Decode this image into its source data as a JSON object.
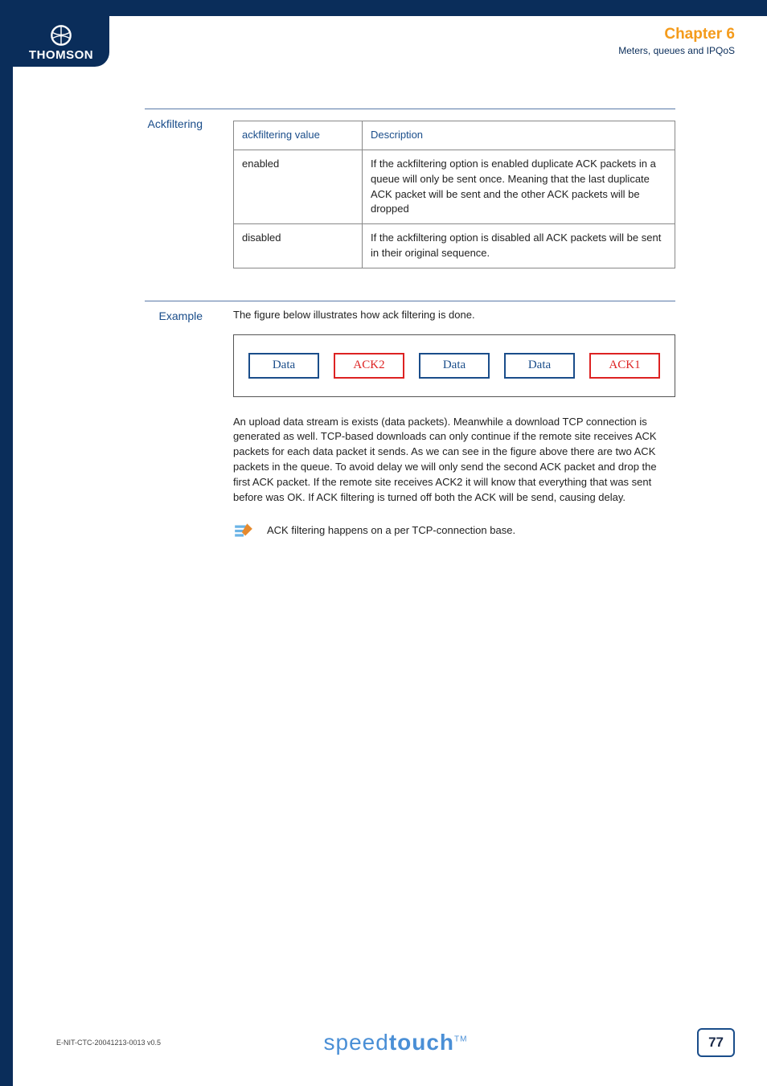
{
  "header": {
    "logo_text": "THOMSON",
    "chapter_title": "Chapter 6",
    "chapter_sub": "Meters, queues and IPQoS"
  },
  "section1": {
    "label": "Ackfiltering",
    "table": {
      "headers": [
        "ackfiltering value",
        "Description"
      ],
      "rows": [
        {
          "c0": "enabled",
          "c1": "If the ackfiltering option is enabled duplicate ACK packets in a queue will only be sent once. Meaning that the last duplicate ACK packet will be sent and the other ACK packets will be dropped"
        },
        {
          "c0": "disabled",
          "c1": "If the ackfiltering option is disabled all ACK packets will be sent in their original sequence."
        }
      ]
    }
  },
  "section2": {
    "label": "Example",
    "intro": "The figure below illustrates how ack filtering is done.",
    "packets": [
      {
        "label": "Data",
        "kind": "data"
      },
      {
        "label": "ACK2",
        "kind": "ack"
      },
      {
        "label": "Data",
        "kind": "data"
      },
      {
        "label": "Data",
        "kind": "data"
      },
      {
        "label": "ACK1",
        "kind": "ack"
      }
    ],
    "para": "An upload data stream is exists (data packets). Meanwhile a download TCP connection is generated as well. TCP-based downloads can only continue if the remote site receives ACK packets for each data packet it sends. As we can see in the figure above there are two ACK packets in the queue. To avoid delay we will only send the second ACK packet and drop the first ACK packet. If the remote site receives ACK2 it will know that everything that was sent before was OK. If ACK filtering is turned off both the ACK will be send, causing delay.",
    "note": "ACK filtering happens on a per TCP-connection base."
  },
  "footer": {
    "doc_id": "E-NIT-CTC-20041213-0013 v0.5",
    "brand_light": "speed",
    "brand_bold": "touch",
    "brand_tm": "TM",
    "page": "77"
  }
}
